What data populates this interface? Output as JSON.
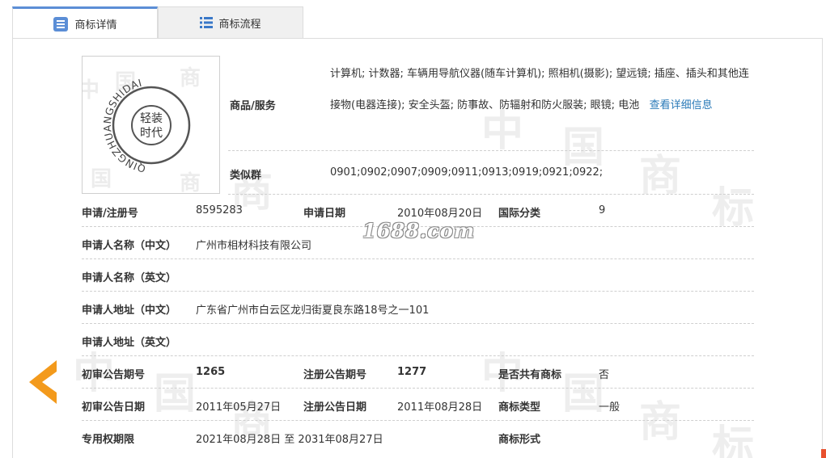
{
  "tabs": [
    {
      "label": "商标详情",
      "active": true
    },
    {
      "label": "商标流程",
      "active": false
    }
  ],
  "logo": {
    "text_line1": "轻装",
    "text_line2": "时代",
    "ring_text": "QINGZHUANGSHIDAI"
  },
  "goods": {
    "label": "商品/服务",
    "text": "计算机; 计数器; 车辆用导航仪器(随车计算机); 照相机(摄影); 望远镜; 插座、插头和其他连接物(电器连接); 安全头盔; 防事故、防辐射和防火服装; 眼镜; 电池",
    "more_link": "查看详细信息"
  },
  "similar_group": {
    "label": "类似群",
    "value": "0901;0902;0907;0909;0911;0913;0919;0921;0922;"
  },
  "fields": {
    "reg_no_label": "申请/注册号",
    "reg_no": "8595283",
    "apply_date_label": "申请日期",
    "apply_date": "2010年08月20日",
    "intl_class_label": "国际分类",
    "intl_class": "9",
    "applicant_cn_label": "申请人名称（中文）",
    "applicant_cn": "广州市相材科技有限公司",
    "applicant_en_label": "申请人名称（英文）",
    "applicant_en": "",
    "address_cn_label": "申请人地址（中文）",
    "address_cn": "广东省广州市白云区龙归街夏良东路18号之一101",
    "address_en_label": "申请人地址（英文）",
    "address_en": "",
    "prelim_issue_label": "初审公告期号",
    "prelim_issue": "1265",
    "reg_issue_label": "注册公告期号",
    "reg_issue": "1277",
    "shared_label": "是否共有商标",
    "shared": "否",
    "prelim_date_label": "初审公告日期",
    "prelim_date": "2011年05月27日",
    "reg_date_label": "注册公告日期",
    "reg_date": "2011年08月28日",
    "mark_type_label": "商标类型",
    "mark_type": "一般",
    "term_label": "专用权期限",
    "term": "2021年08月28日 至 2031年08月27日",
    "mark_form_label": "商标形式",
    "mark_form": ""
  },
  "watermark_text": "1688.com",
  "colors": {
    "accent": "#5b8ed6",
    "link": "#2a7ab8",
    "arrow": "#f39a1c"
  }
}
